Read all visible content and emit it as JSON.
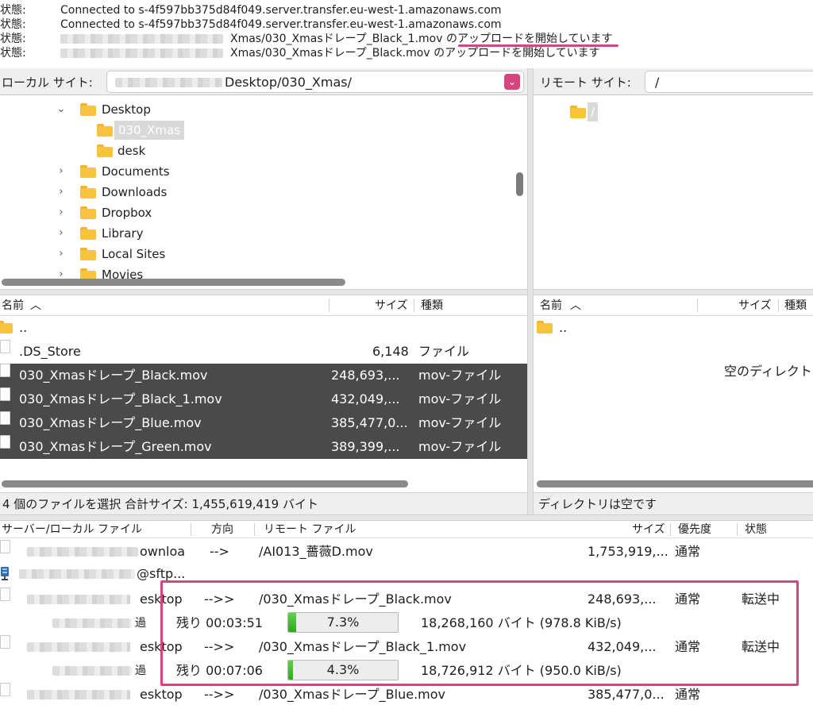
{
  "log": [
    {
      "label": "状態:",
      "msg": "Connected to s-4f597bb375d84f049.server.transfer.eu-west-1.amazonaws.com"
    },
    {
      "label": "状態:",
      "msg": "Connected to s-4f597bb375d84f049.server.transfer.eu-west-1.amazonaws.com"
    },
    {
      "label": "状態:",
      "msg": "Xmas/030_Xmasドレープ_Black_1.mov のアップロードを開始しています"
    },
    {
      "label": "状態:",
      "msg": "Xmas/030_Xmasドレープ_Black.mov のアップロードを開始しています"
    }
  ],
  "local_site": {
    "label": "ローカル サイト:",
    "path": "Desktop/030_Xmas/"
  },
  "remote_site": {
    "label": "リモート サイト:",
    "path": "/"
  },
  "local_tree": [
    {
      "name": "Desktop",
      "expanded": true
    },
    {
      "name": "030_Xmas",
      "selected": true
    },
    {
      "name": "desk"
    },
    {
      "name": "Documents"
    },
    {
      "name": "Downloads"
    },
    {
      "name": "Dropbox"
    },
    {
      "name": "Library"
    },
    {
      "name": "Local Sites"
    },
    {
      "name": "Movies"
    }
  ],
  "remote_tree": [
    {
      "name": "/"
    }
  ],
  "local_list": {
    "headers": {
      "name": "名前",
      "size": "サイズ",
      "type": "種類"
    },
    "rows": [
      {
        "name": "..",
        "size": "",
        "type": ""
      },
      {
        "name": ".DS_Store",
        "size": "6,148",
        "type": "ファイル"
      },
      {
        "name": "030_Xmasドレープ_Black.mov",
        "size": "248,693,...",
        "type": "mov-ファイル"
      },
      {
        "name": "030_Xmasドレープ_Black_1.mov",
        "size": "432,049,...",
        "type": "mov-ファイル"
      },
      {
        "name": "030_Xmasドレープ_Blue.mov",
        "size": "385,477,0...",
        "type": "mov-ファイル"
      },
      {
        "name": "030_Xmasドレープ_Green.mov",
        "size": "389,399,...",
        "type": "mov-ファイル"
      }
    ],
    "status": "4 個のファイルを選択 合計サイズ: 1,455,619,419 バイト"
  },
  "remote_list": {
    "headers": {
      "name": "名前",
      "size": "サイズ",
      "type": "種類"
    },
    "parent": "..",
    "empty_text": "空のディレクト",
    "status": "ディレクトリは空です"
  },
  "queue": {
    "headers": {
      "server": "サーバー/ローカル ファイル",
      "direction": "方向",
      "remote": "リモート ファイル",
      "size": "サイズ",
      "priority": "優先度",
      "status": "状態"
    },
    "items": [
      {
        "local": "ownloa",
        "direction": "-->",
        "remote": "/AI013_薔薇D.mov",
        "size": "1,753,919,...",
        "priority": "通常",
        "status": ""
      },
      {
        "local": "@sftp...",
        "direction": "",
        "remote": "",
        "size": "",
        "priority": "",
        "status": ""
      },
      {
        "local": "esktop",
        "direction": "-->>",
        "remote": "/030_Xmasドレープ_Black.mov",
        "size": "248,693,...",
        "priority": "通常",
        "status": "転送中"
      },
      {
        "local": "esktop",
        "direction": "-->>",
        "remote": "/030_Xmasドレープ_Black_1.mov",
        "size": "432,049,...",
        "priority": "通常",
        "status": "転送中"
      },
      {
        "local": "esktop",
        "direction": "-->>",
        "remote": "/030_Xmasドレープ_Blue.mov",
        "size": "385,477,0...",
        "priority": "通常",
        "status": ""
      }
    ],
    "progress": [
      {
        "elapsed_char": "過",
        "remaining": "残り 00:03:51",
        "percent": 7.3,
        "percent_label": "7.3%",
        "bytes": "18,268,160 バイト (978.8 KiB/s)"
      },
      {
        "elapsed_char": "過",
        "remaining": "残り 00:07:06",
        "percent": 4.3,
        "percent_label": "4.3%",
        "bytes": "18,726,912 バイト (950.0 KiB/s)"
      }
    ]
  },
  "colors": {
    "highlight": "#d6457f",
    "progress": "#3dbb2a",
    "selection": "#4a4a4a"
  }
}
